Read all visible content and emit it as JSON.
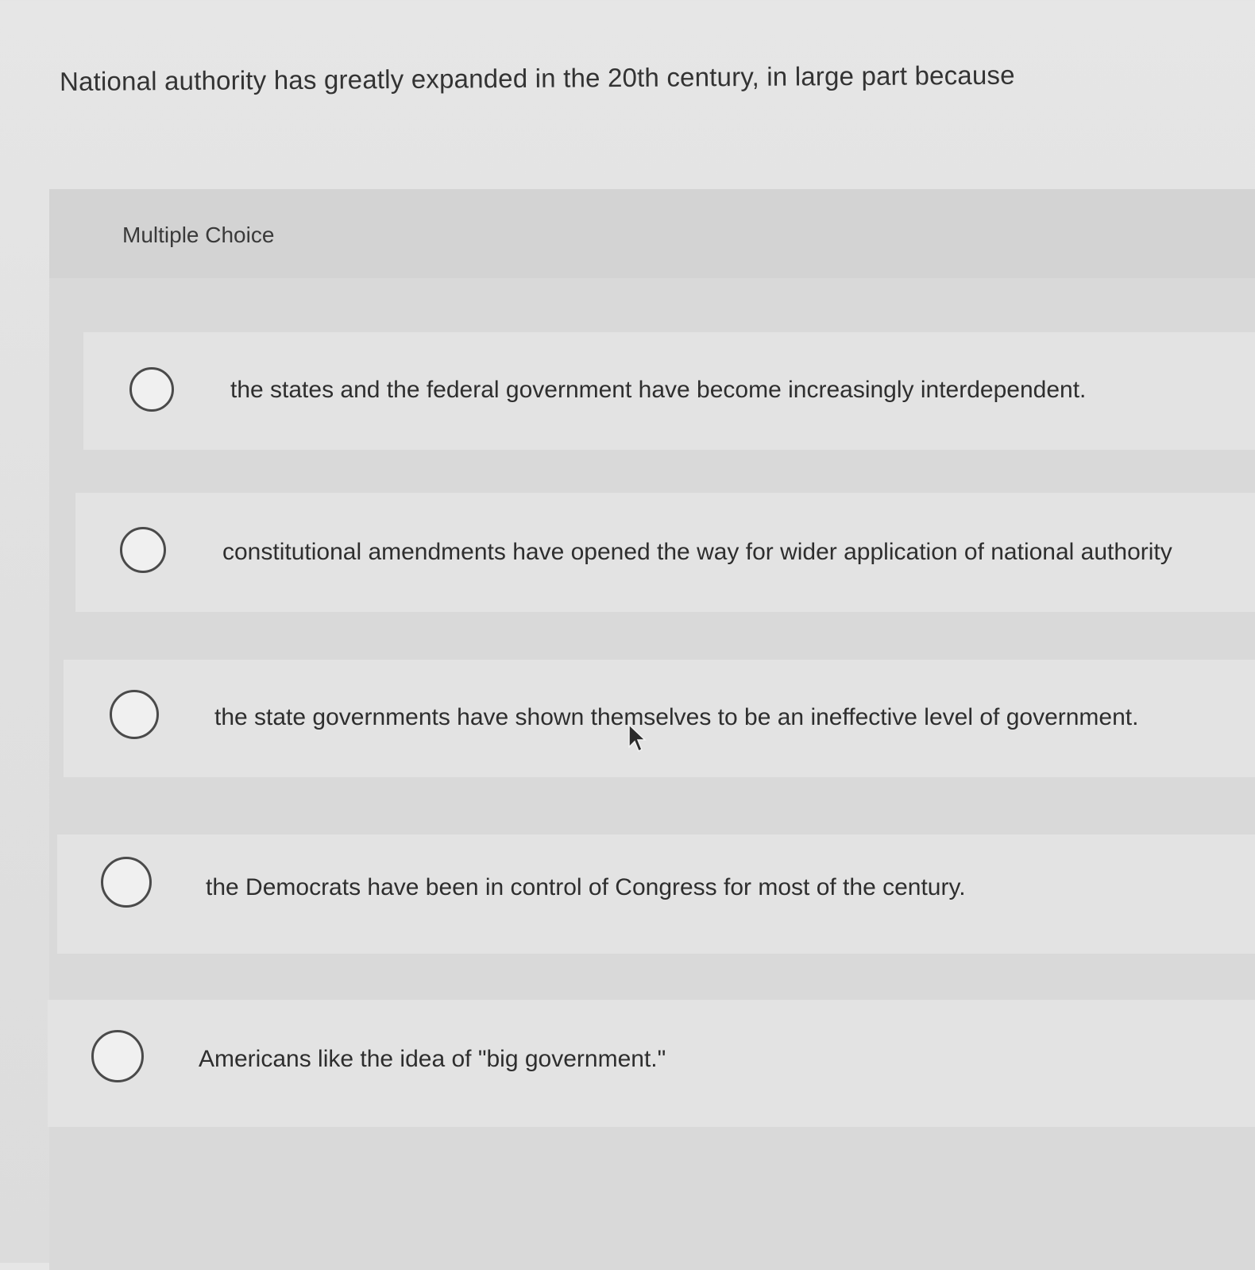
{
  "question": {
    "text": "National authority has greatly expanded in the 20th century, in large part because"
  },
  "multiple_choice": {
    "label": "Multiple Choice",
    "options": [
      {
        "text": "the states and the federal government have become increasingly interdependent.",
        "selected": false
      },
      {
        "text": "constitutional amendments have opened the way for wider application of national authority",
        "selected": false
      },
      {
        "text": "the state governments have shown themselves to be an ineffective level of government.",
        "selected": false
      },
      {
        "text": "the Democrats have been in control of Congress for most of the century.",
        "selected": false
      },
      {
        "text": "Americans like the idea of \"big government.\"",
        "selected": false
      }
    ]
  }
}
